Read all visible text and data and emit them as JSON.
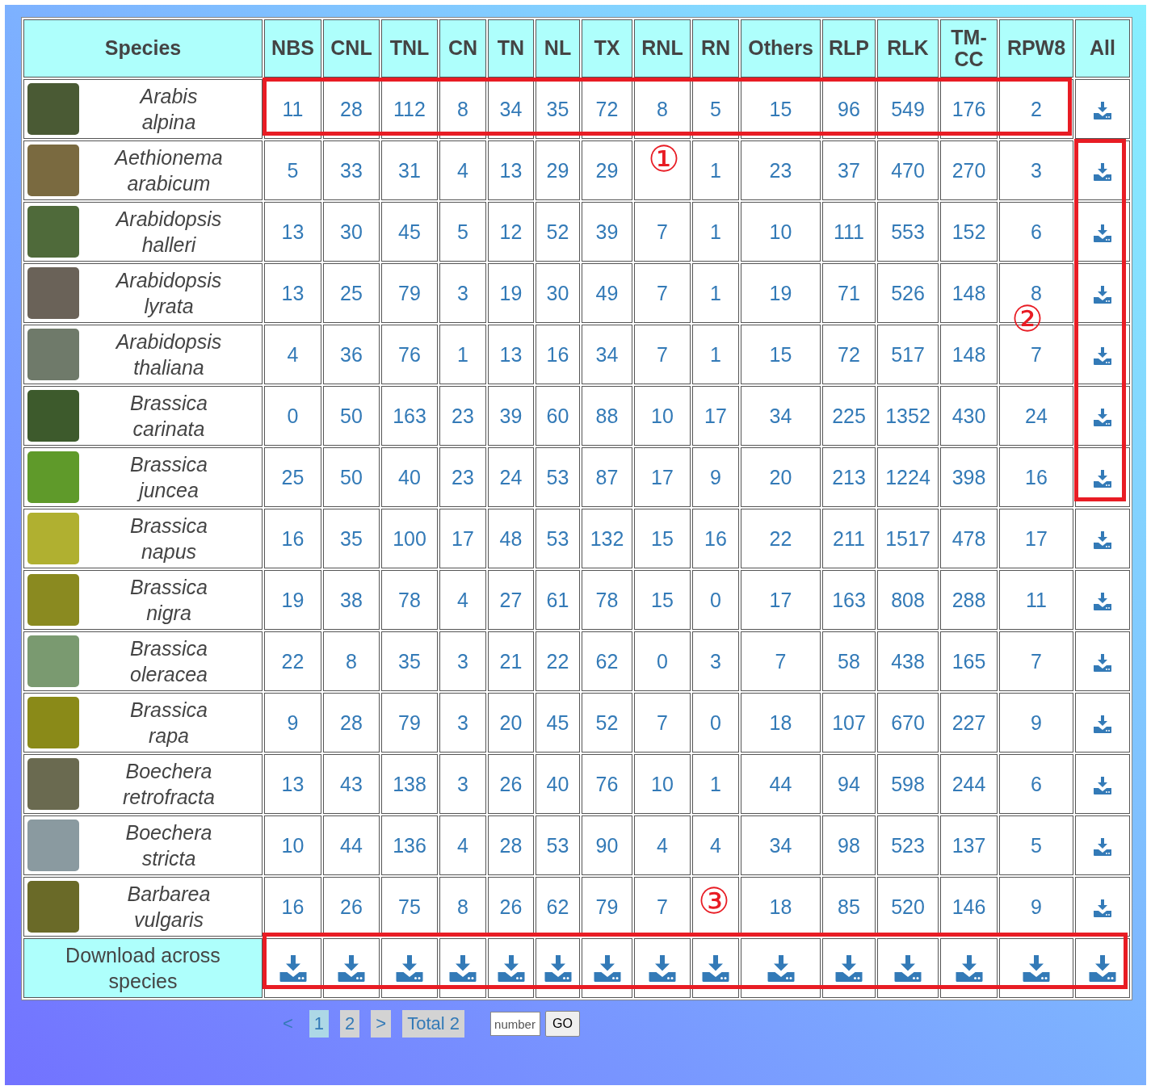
{
  "table": {
    "columns": [
      "Species",
      "NBS",
      "CNL",
      "TNL",
      "CN",
      "TN",
      "NL",
      "TX",
      "RNL",
      "RN",
      "Others",
      "RLP",
      "RLK",
      "TM-CC",
      "RPW8",
      "All"
    ],
    "rows": [
      {
        "genus": "Arabis",
        "epithet": "alpina",
        "values": [
          "11",
          "28",
          "112",
          "8",
          "34",
          "35",
          "72",
          "8",
          "5",
          "15",
          "96",
          "549",
          "176",
          "2"
        ]
      },
      {
        "genus": "Aethionema",
        "epithet": "arabicum",
        "values": [
          "5",
          "33",
          "31",
          "4",
          "13",
          "29",
          "29",
          {
            "covered": true
          },
          "1",
          "23",
          "37",
          "470",
          "270",
          "3"
        ]
      },
      {
        "genus": "Arabidopsis",
        "epithet": "halleri",
        "values": [
          "13",
          "30",
          "45",
          "5",
          "12",
          "52",
          "39",
          "7",
          "1",
          "10",
          "111",
          "553",
          "152",
          "6"
        ]
      },
      {
        "genus": "Arabidopsis",
        "epithet": "lyrata",
        "values": [
          "13",
          "25",
          "79",
          "3",
          "19",
          "30",
          "49",
          "7",
          "1",
          "19",
          "71",
          "526",
          "148",
          "8"
        ]
      },
      {
        "genus": "Arabidopsis",
        "epithet": "thaliana",
        "values": [
          "4",
          "36",
          "76",
          "1",
          "13",
          "16",
          "34",
          "7",
          "1",
          "15",
          "72",
          "517",
          "148",
          "7"
        ]
      },
      {
        "genus": "Brassica",
        "epithet": "carinata",
        "values": [
          "0",
          "50",
          "163",
          "23",
          "39",
          "60",
          "88",
          "10",
          "17",
          "34",
          "225",
          "1352",
          "430",
          "24"
        ]
      },
      {
        "genus": "Brassica",
        "epithet": "juncea",
        "values": [
          "25",
          "50",
          "40",
          "23",
          "24",
          "53",
          "87",
          "17",
          "9",
          "20",
          "213",
          "1224",
          "398",
          "16"
        ]
      },
      {
        "genus": "Brassica",
        "epithet": "napus",
        "values": [
          "16",
          "35",
          "100",
          "17",
          "48",
          "53",
          "132",
          "15",
          "16",
          "22",
          "211",
          "1517",
          "478",
          "17"
        ]
      },
      {
        "genus": "Brassica",
        "epithet": "nigra",
        "values": [
          "19",
          "38",
          "78",
          "4",
          "27",
          "61",
          "78",
          "15",
          "0",
          "17",
          "163",
          "808",
          "288",
          "11"
        ]
      },
      {
        "genus": "Brassica",
        "epithet": "oleracea",
        "values": [
          "22",
          "8",
          "35",
          "3",
          "21",
          "22",
          "62",
          "0",
          "3",
          "7",
          "58",
          "438",
          "165",
          "7"
        ]
      },
      {
        "genus": "Brassica",
        "epithet": "rapa",
        "values": [
          "9",
          "28",
          "79",
          "3",
          "20",
          "45",
          "52",
          "7",
          "0",
          "18",
          "107",
          "670",
          "227",
          "9"
        ]
      },
      {
        "genus": "Boechera",
        "epithet": "retrofracta",
        "values": [
          "13",
          "43",
          "138",
          "3",
          "26",
          "40",
          "76",
          "10",
          "1",
          "44",
          "94",
          "598",
          "244",
          "6"
        ]
      },
      {
        "genus": "Boechera",
        "epithet": "stricta",
        "values": [
          "10",
          "44",
          "136",
          "4",
          "28",
          "53",
          "90",
          "4",
          "4",
          "34",
          "98",
          "523",
          "137",
          "5"
        ]
      },
      {
        "genus": "Barbarea",
        "epithet": "vulgaris",
        "values": [
          "16",
          "26",
          "75",
          "8",
          "26",
          "62",
          "79",
          "7",
          {
            "covered": true
          },
          "18",
          "85",
          "520",
          "146",
          "9"
        ]
      }
    ],
    "footer_label": "Download across species"
  },
  "annotations": [
    {
      "label": "①"
    },
    {
      "label": "②"
    },
    {
      "label": "③"
    }
  ],
  "pagination": {
    "prev": "<",
    "pages": [
      {
        "label": "1",
        "selected": true
      },
      {
        "label": "2",
        "selected": false
      }
    ],
    "next": ">",
    "total": "Total 2",
    "jump": {
      "placeholder": "number"
    },
    "go": "GO"
  }
}
